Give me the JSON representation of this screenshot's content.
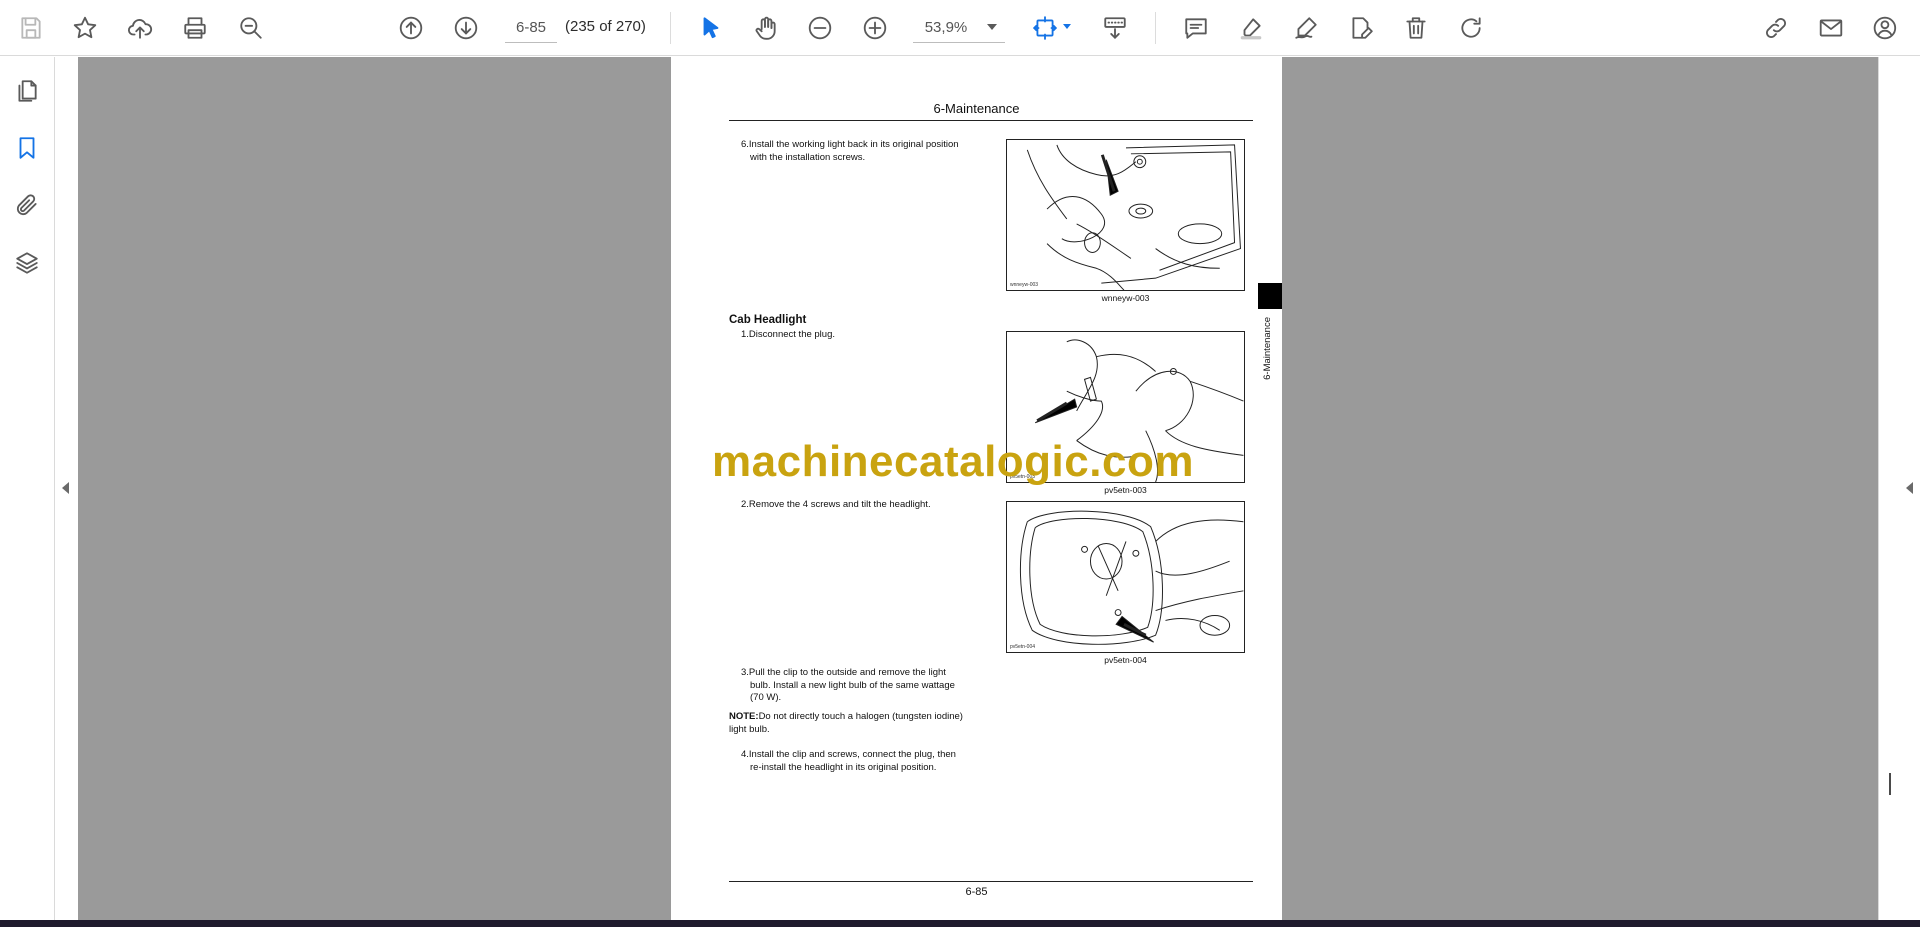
{
  "toolbar": {
    "page_value": "6-85",
    "page_of": "(235 of 270)",
    "zoom_value": "53,9%",
    "icons": [
      "save-icon",
      "bookmark-star-icon",
      "upload-cloud-icon",
      "print-icon",
      "find-zoom-icon",
      "previous-page-icon",
      "next-page-icon",
      "select-cursor-icon",
      "hand-tool-icon",
      "zoom-out-icon",
      "zoom-in-icon",
      "fit-page-icon",
      "scroll-mode-icon",
      "comment-icon",
      "highlight-icon",
      "draw-icon",
      "fill-sign-icon",
      "delete-icon",
      "rotate-icon",
      "share-link-icon",
      "email-icon",
      "user-account-icon"
    ]
  },
  "sidebar": {
    "icons": [
      "pages-thumbnails-icon",
      "bookmarks-icon",
      "attachments-icon",
      "layers-icon"
    ]
  },
  "document": {
    "header": "6-Maintenance",
    "step6": [
      "6.Install the working light back in its original position",
      "with the installation screws."
    ],
    "fig1_code": "wnneyw-003",
    "fig1_caption": "wnneyw-003",
    "section_title": "Cab Headlight",
    "step1": "1.Disconnect the plug.",
    "fig2_code": "pv5etn-003",
    "fig2_caption": "pv5etn-003",
    "step2": "2.Remove the 4 screws and tilt the headlight.",
    "fig3_code": "pv5etn-004",
    "fig3_caption": "pv5etn-004",
    "step3": [
      "3.Pull the clip to the outside and remove the light",
      "bulb.  Install a new light bulb of the same wattage",
      "(70 W)."
    ],
    "note_label": "NOTE:",
    "note_text": "Do not directly touch a halogen (tungsten iodine)",
    "note_text2": "light bulb.",
    "step4": [
      "4.Install the clip and screws, connect the plug, then",
      "re-install the headlight in its original position."
    ],
    "side_tab": "6-Maintenance",
    "page_number": "6-85"
  },
  "watermark": "machinecatalogic.com",
  "colors": {
    "accent": "#1473e6",
    "viewer_bg": "#9a9a9a",
    "watermark": "#c9a310"
  }
}
